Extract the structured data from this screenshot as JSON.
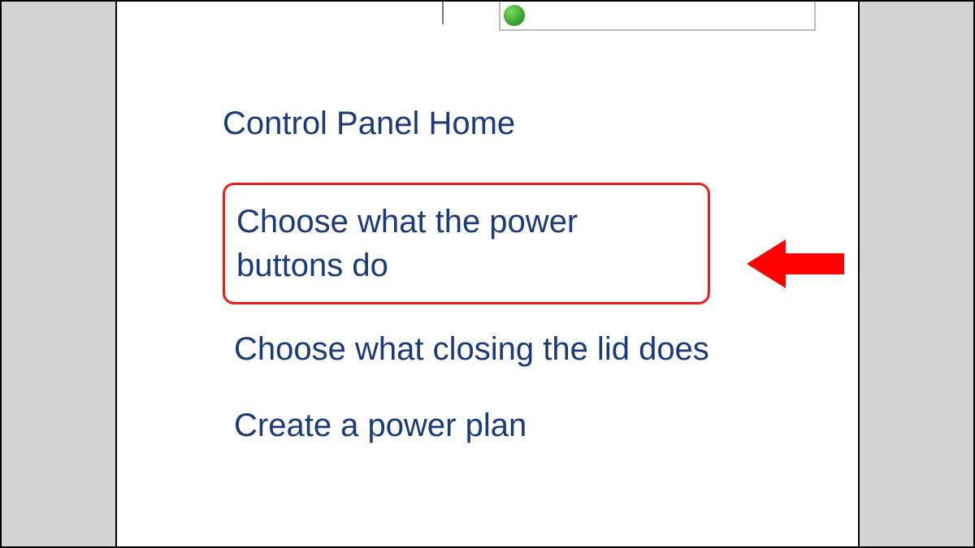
{
  "sidebar": {
    "heading": "Control Panel Home",
    "links": [
      {
        "label": "Choose what the power buttons do"
      },
      {
        "label": "Choose what closing the lid does"
      },
      {
        "label": "Create a power plan"
      }
    ]
  },
  "colors": {
    "highlight_border": "#e62020",
    "link_text": "#1a3a7a",
    "arrow_fill": "#ff0000"
  }
}
